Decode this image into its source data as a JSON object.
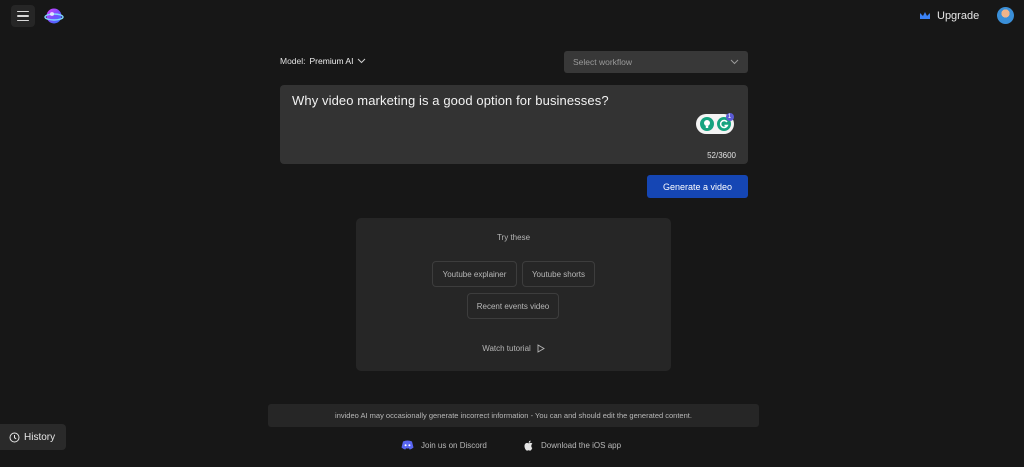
{
  "header": {
    "menu_icon": "hamburger-icon",
    "logo_icon": "invideo-logo",
    "upgrade_label": "Upgrade",
    "upgrade_icon": "crown-icon",
    "avatar_icon": "user-avatar"
  },
  "model": {
    "prefix": "Model:",
    "value": "Premium AI"
  },
  "workflow": {
    "placeholder": "Select workflow"
  },
  "prompt": {
    "text": "Why video marketing is a good option for businesses?",
    "counter": "52/3600",
    "grammarly_badge": "1"
  },
  "generate_label": "Generate a video",
  "try_these": {
    "title": "Try these",
    "chips": [
      "Youtube explainer",
      "Youtube shorts",
      "Recent events video"
    ],
    "tutorial_label": "Watch tutorial"
  },
  "disclaimer": "invideo AI may occasionally generate incorrect information - You can and should edit the generated content.",
  "footer": {
    "discord_label": "Join us on Discord",
    "ios_label": "Download the iOS app"
  },
  "history_label": "History",
  "colors": {
    "background": "#171717",
    "primary_button": "#1546b4",
    "accent": "#3b82f6"
  }
}
